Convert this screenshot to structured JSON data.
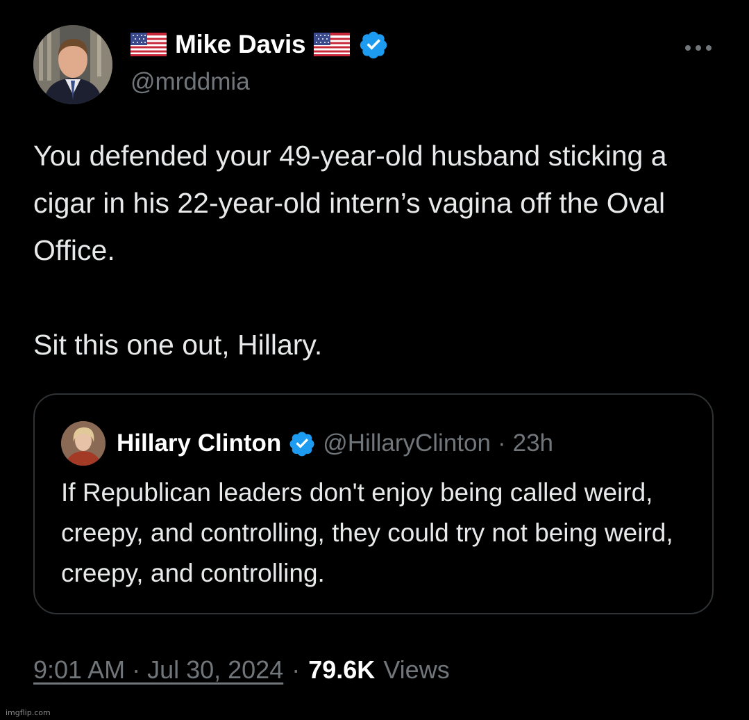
{
  "author": {
    "display_name": "Mike Davis",
    "handle": "@mrddmia",
    "verified": true,
    "avatar_icon": "man-in-suit-portrait",
    "flag_icon": "us-flag-icon"
  },
  "tweet": {
    "text": "You defended your 49-year-old husband sticking a cigar in his 22-year-old intern’s vagina off the Oval Office.\n\nSit this one out, Hillary."
  },
  "quoted_tweet": {
    "display_name": "Hillary Clinton",
    "handle": "@HillaryClinton",
    "separator": "·",
    "relative_time": "23h",
    "verified": true,
    "text": "If Republican leaders don't enjoy being called weird, creepy, and controlling, they could try not being weird, creepy, and controlling."
  },
  "meta": {
    "timestamp": "9:01 AM · Jul 30, 2024",
    "separator": "·",
    "views_count": "79.6K",
    "views_label": "Views"
  },
  "watermark": "imgflip.com",
  "colors": {
    "background": "#000000",
    "primary_text": "#e7e9ea",
    "secondary_text": "#71767b",
    "verified_blue": "#1d9bf0",
    "border": "#2f3336"
  }
}
